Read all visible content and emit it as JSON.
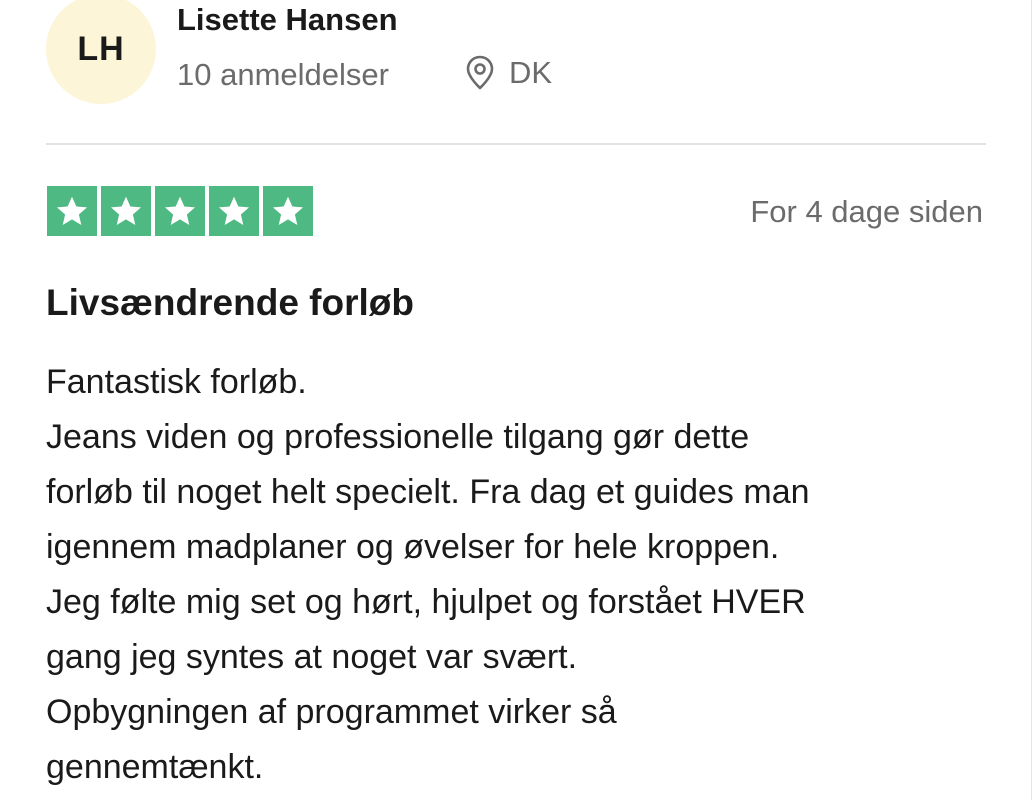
{
  "reviewer": {
    "initials": "LH",
    "name": "Lisette Hansen",
    "review_count": "10 anmeldelser",
    "country": "DK"
  },
  "review": {
    "rating": 5,
    "max_rating": 5,
    "date": "For 4 dage siden",
    "title": "Livsændrende forløb",
    "body_lines": [
      "Fantastisk forløb.",
      "Jeans viden og professionelle tilgang gør dette",
      "forløb til noget helt specielt. Fra dag et guides man",
      "igennem madplaner og øvelser for hele kroppen.",
      "Jeg følte mig set og hørt, hjulpet og forstået HVER",
      "gang jeg syntes at noget var svært.",
      "Opbygningen af programmet virker så",
      "gennemtænkt."
    ]
  },
  "icons": {
    "location": "location-pin-icon",
    "star": "star-icon"
  },
  "colors": {
    "star_green": "#4fb983",
    "avatar_bg": "#fcf5d7",
    "muted_text": "#6b6b6b"
  }
}
